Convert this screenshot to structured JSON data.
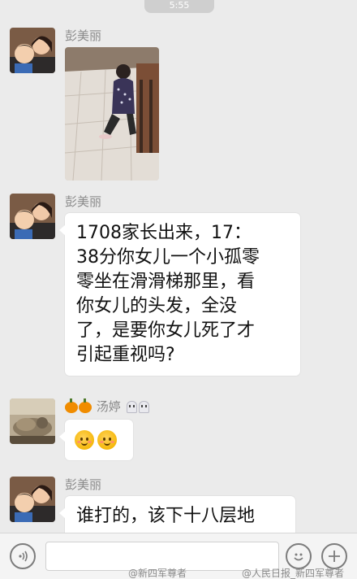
{
  "status": {
    "time": "5:55"
  },
  "messages": [
    {
      "sender": "彭美丽"
    },
    {
      "sender": "彭美丽",
      "text_lines": [
        "1708家长出来，17：",
        "38分你女儿一个小孤零",
        "零坐在滑滑梯那里，看",
        "你女儿的头发，全没",
        "了，是要你女儿死了才",
        "引起重视吗?"
      ]
    },
    {
      "sender": "汤婷"
    },
    {
      "sender": "彭美丽",
      "text": "谁打的，该下十八层地"
    }
  ],
  "watermarks": [
    "@新四军尊者",
    "@人民日报_新四军尊者"
  ],
  "icons": {
    "voice": "voice-icon",
    "emoji": "emoji-icon",
    "plus": "plus-icon"
  },
  "colors": {
    "background": "#ebebeb",
    "bubble": "#ffffff",
    "sender": "#8a8a8a"
  }
}
